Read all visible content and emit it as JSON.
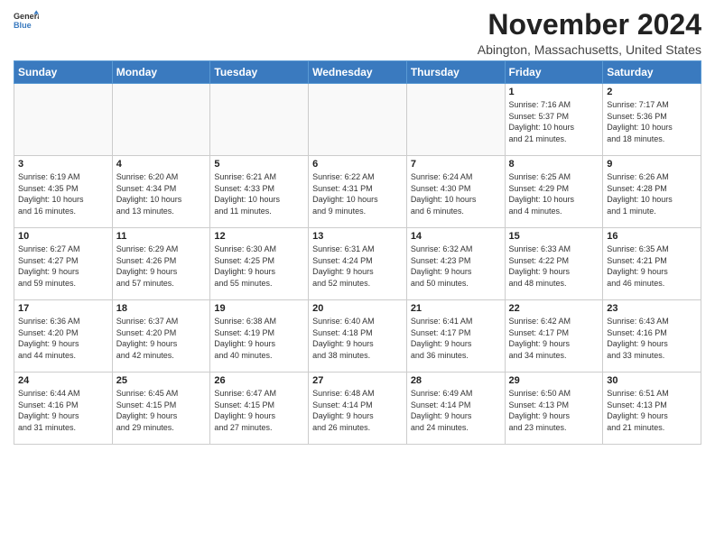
{
  "header": {
    "logo_line1": "General",
    "logo_line2": "Blue",
    "month": "November 2024",
    "location": "Abington, Massachusetts, United States"
  },
  "weekdays": [
    "Sunday",
    "Monday",
    "Tuesday",
    "Wednesday",
    "Thursday",
    "Friday",
    "Saturday"
  ],
  "weeks": [
    [
      {
        "day": "",
        "info": ""
      },
      {
        "day": "",
        "info": ""
      },
      {
        "day": "",
        "info": ""
      },
      {
        "day": "",
        "info": ""
      },
      {
        "day": "",
        "info": ""
      },
      {
        "day": "1",
        "info": "Sunrise: 7:16 AM\nSunset: 5:37 PM\nDaylight: 10 hours\nand 21 minutes."
      },
      {
        "day": "2",
        "info": "Sunrise: 7:17 AM\nSunset: 5:36 PM\nDaylight: 10 hours\nand 18 minutes."
      }
    ],
    [
      {
        "day": "3",
        "info": "Sunrise: 6:19 AM\nSunset: 4:35 PM\nDaylight: 10 hours\nand 16 minutes."
      },
      {
        "day": "4",
        "info": "Sunrise: 6:20 AM\nSunset: 4:34 PM\nDaylight: 10 hours\nand 13 minutes."
      },
      {
        "day": "5",
        "info": "Sunrise: 6:21 AM\nSunset: 4:33 PM\nDaylight: 10 hours\nand 11 minutes."
      },
      {
        "day": "6",
        "info": "Sunrise: 6:22 AM\nSunset: 4:31 PM\nDaylight: 10 hours\nand 9 minutes."
      },
      {
        "day": "7",
        "info": "Sunrise: 6:24 AM\nSunset: 4:30 PM\nDaylight: 10 hours\nand 6 minutes."
      },
      {
        "day": "8",
        "info": "Sunrise: 6:25 AM\nSunset: 4:29 PM\nDaylight: 10 hours\nand 4 minutes."
      },
      {
        "day": "9",
        "info": "Sunrise: 6:26 AM\nSunset: 4:28 PM\nDaylight: 10 hours\nand 1 minute."
      }
    ],
    [
      {
        "day": "10",
        "info": "Sunrise: 6:27 AM\nSunset: 4:27 PM\nDaylight: 9 hours\nand 59 minutes."
      },
      {
        "day": "11",
        "info": "Sunrise: 6:29 AM\nSunset: 4:26 PM\nDaylight: 9 hours\nand 57 minutes."
      },
      {
        "day": "12",
        "info": "Sunrise: 6:30 AM\nSunset: 4:25 PM\nDaylight: 9 hours\nand 55 minutes."
      },
      {
        "day": "13",
        "info": "Sunrise: 6:31 AM\nSunset: 4:24 PM\nDaylight: 9 hours\nand 52 minutes."
      },
      {
        "day": "14",
        "info": "Sunrise: 6:32 AM\nSunset: 4:23 PM\nDaylight: 9 hours\nand 50 minutes."
      },
      {
        "day": "15",
        "info": "Sunrise: 6:33 AM\nSunset: 4:22 PM\nDaylight: 9 hours\nand 48 minutes."
      },
      {
        "day": "16",
        "info": "Sunrise: 6:35 AM\nSunset: 4:21 PM\nDaylight: 9 hours\nand 46 minutes."
      }
    ],
    [
      {
        "day": "17",
        "info": "Sunrise: 6:36 AM\nSunset: 4:20 PM\nDaylight: 9 hours\nand 44 minutes."
      },
      {
        "day": "18",
        "info": "Sunrise: 6:37 AM\nSunset: 4:20 PM\nDaylight: 9 hours\nand 42 minutes."
      },
      {
        "day": "19",
        "info": "Sunrise: 6:38 AM\nSunset: 4:19 PM\nDaylight: 9 hours\nand 40 minutes."
      },
      {
        "day": "20",
        "info": "Sunrise: 6:40 AM\nSunset: 4:18 PM\nDaylight: 9 hours\nand 38 minutes."
      },
      {
        "day": "21",
        "info": "Sunrise: 6:41 AM\nSunset: 4:17 PM\nDaylight: 9 hours\nand 36 minutes."
      },
      {
        "day": "22",
        "info": "Sunrise: 6:42 AM\nSunset: 4:17 PM\nDaylight: 9 hours\nand 34 minutes."
      },
      {
        "day": "23",
        "info": "Sunrise: 6:43 AM\nSunset: 4:16 PM\nDaylight: 9 hours\nand 33 minutes."
      }
    ],
    [
      {
        "day": "24",
        "info": "Sunrise: 6:44 AM\nSunset: 4:16 PM\nDaylight: 9 hours\nand 31 minutes."
      },
      {
        "day": "25",
        "info": "Sunrise: 6:45 AM\nSunset: 4:15 PM\nDaylight: 9 hours\nand 29 minutes."
      },
      {
        "day": "26",
        "info": "Sunrise: 6:47 AM\nSunset: 4:15 PM\nDaylight: 9 hours\nand 27 minutes."
      },
      {
        "day": "27",
        "info": "Sunrise: 6:48 AM\nSunset: 4:14 PM\nDaylight: 9 hours\nand 26 minutes."
      },
      {
        "day": "28",
        "info": "Sunrise: 6:49 AM\nSunset: 4:14 PM\nDaylight: 9 hours\nand 24 minutes."
      },
      {
        "day": "29",
        "info": "Sunrise: 6:50 AM\nSunset: 4:13 PM\nDaylight: 9 hours\nand 23 minutes."
      },
      {
        "day": "30",
        "info": "Sunrise: 6:51 AM\nSunset: 4:13 PM\nDaylight: 9 hours\nand 21 minutes."
      }
    ]
  ]
}
